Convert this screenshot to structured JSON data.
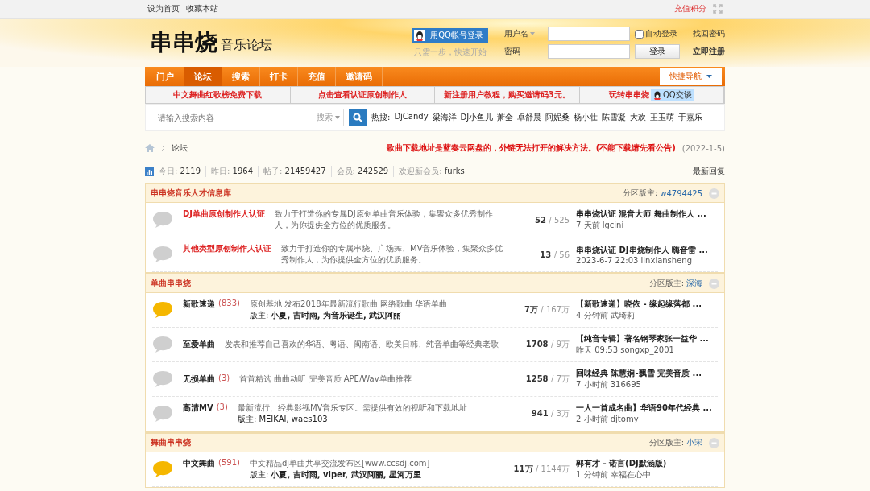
{
  "topbar": {
    "left_links": [
      "设为首页",
      "收藏本站"
    ],
    "right_link": "充值积分"
  },
  "header": {
    "logo": "串串烧",
    "logo_sub": "音乐论坛",
    "qq_login": "用QQ帐号登录",
    "qq_hint": "只需一步，快速开始",
    "login": {
      "username_label": "用户名",
      "password_label": "密码",
      "auto_login": {
        "label": "自动登录",
        "checked": false
      },
      "forgot": "找回密码",
      "submit": "登录",
      "register": "立即注册"
    }
  },
  "nav": {
    "tabs": [
      {
        "label": "门户",
        "selected": false
      },
      {
        "label": "论坛",
        "selected": true
      },
      {
        "label": "搜索",
        "selected": false
      },
      {
        "label": "打卡",
        "selected": false
      },
      {
        "label": "充值",
        "selected": false
      },
      {
        "label": "邀请码",
        "selected": false
      }
    ],
    "quick_nav": "快捷导航"
  },
  "promo_links": [
    "中文舞曲红歌榜免费下载",
    "点击查看认证原创制作人",
    "新注册用户教程，购买邀请码3元。",
    "玩转串串烧"
  ],
  "qq_chat": "QQ交谈",
  "search": {
    "placeholder": "请输入搜索内容",
    "scope": "搜索",
    "hot_label": "热搜:",
    "hot": [
      "DjCandy",
      "梁海洋",
      "DJ小鱼儿",
      "萧全",
      "卓舒晨",
      "阿妮桑",
      "杨小壮",
      "陈雪凝",
      "大欢",
      "王玉萌",
      "于嘉乐"
    ]
  },
  "breadcrumb": {
    "current": "论坛",
    "notice": "歌曲下载地址是蓝奏云网盘的，外链无法打开的解决方法。(不能下载请先看公告)",
    "notice_date": "(2022-1-5)"
  },
  "stats": {
    "items": [
      {
        "label": "今日:",
        "value": "2119"
      },
      {
        "label": "昨日:",
        "value": "1964"
      },
      {
        "label": "帖子:",
        "value": "21459427"
      },
      {
        "label": "会员:",
        "value": "242529"
      },
      {
        "label": "欢迎新会员:",
        "value": "furks"
      }
    ],
    "latest": "最新回复"
  },
  "sections": [
    {
      "title": "串串烧音乐人才信息库",
      "mod_label": "分区版主:",
      "moderator": "w4794425",
      "forums": [
        {
          "name": "DJ单曲原创制作人认证",
          "highlighted": true,
          "has_new": false,
          "desc": "致力于打造你的专属DJ原创单曲音乐体验，集聚众多优秀制作人，为你提供全方位的优质服务。",
          "threads": "52",
          "posts": "/ 525",
          "last_title": "串串烧认证 混音大师 舞曲制作人 ...",
          "last_meta": "7 天前 lgcini"
        },
        {
          "name": "其他类型原创制作人认证",
          "highlighted": true,
          "has_new": false,
          "desc": "致力于打造你的专属串烧、广场舞、MV音乐体验，集聚众多优秀制作人，为你提供全方位的优质服务。",
          "threads": "13",
          "posts": "/ 56",
          "last_title": "串串烧认证 DJ串烧制作人 嗨音雷 ...",
          "last_meta": "2023-6-7 22:03 linxiansheng"
        }
      ]
    },
    {
      "title": "单曲串串烧",
      "mod_label": "分区版主:",
      "moderator": "深海",
      "forums": [
        {
          "name": "新歌速递",
          "count": "(833)",
          "highlighted": false,
          "has_new": true,
          "desc": "原创基地 发布2018年最新流行歌曲 网络歌曲 华语单曲",
          "mods": "版主: **小夏, 吉时雨, 为音乐诞生, 武汉阿丽**",
          "threads": "7万",
          "posts": "/ 167万",
          "last_title": "【新歌速递】晓依 - 缘起缘落都 ...",
          "last_meta": "4 分钟前 武琦莉"
        },
        {
          "name": "至爱单曲",
          "highlighted": false,
          "has_new": false,
          "desc": "发表和推荐自己喜欢的华语、粤语、闽南语、欧美日韩、纯音单曲等经典老歌",
          "threads": "1708",
          "posts": "/ 9万",
          "last_title": "【纯音专辑】著名钢琴家张一益华 ...",
          "last_meta": "昨天 09:53 songxp_2001"
        },
        {
          "name": "无损单曲",
          "count": "(3)",
          "highlighted": false,
          "has_new": false,
          "desc": "首首精选 曲曲动听 完美音质 APE/Wav单曲推荐",
          "threads": "1258",
          "posts": "/ 7万",
          "last_title": "回味经典 陈慧娴-飘雪 完美音质 ...",
          "last_meta": "7 小时前 316695"
        },
        {
          "name": "高清MV",
          "count": "(3)",
          "highlighted": false,
          "has_new": false,
          "desc": "最新流行、经典影视MV音乐专区。需提供有效的视听和下载地址",
          "mods": "版主: MEIKAI, waes103",
          "threads": "941",
          "posts": "/ 3万",
          "last_title": "一人一首成名曲】华语90年代经典 ...",
          "last_meta": "2 小时前 djtomy"
        }
      ]
    },
    {
      "title": "舞曲串串烧",
      "mod_label": "分区版主:",
      "moderator": "小宋",
      "forums": [
        {
          "name": "中文舞曲",
          "count": "(591)",
          "highlighted": false,
          "has_new": true,
          "desc": "中文精品dj单曲共享交流发布区[www.ccsdj.com]",
          "mods": "版主: **小夏, 吉时雨, viper, 武汉阿丽, 星河万里**",
          "threads": "11万",
          "posts": "/ 1144万",
          "last_title": "郭有才 - 诺言(DJ默涵版)",
          "last_meta": "1 分钟前 幸福在心中"
        }
      ]
    }
  ]
}
